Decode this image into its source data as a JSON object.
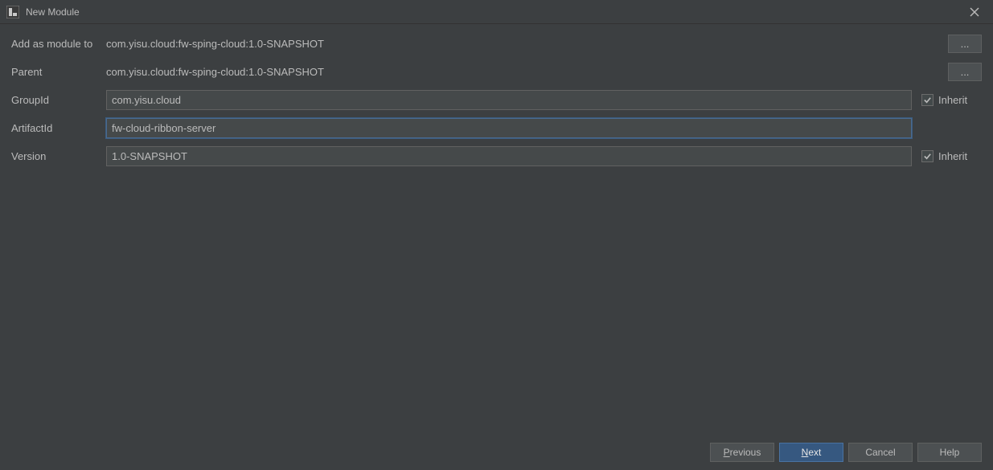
{
  "title": "New Module",
  "labels": {
    "add_as_module_to": "Add as module to",
    "parent": "Parent",
    "group_id": "GroupId",
    "artifact_id": "ArtifactId",
    "version": "Version",
    "inherit": "Inherit"
  },
  "values": {
    "add_as_module_to": "com.yisu.cloud:fw-sping-cloud:1.0-SNAPSHOT",
    "parent": "com.yisu.cloud:fw-sping-cloud:1.0-SNAPSHOT",
    "group_id": "com.yisu.cloud",
    "artifact_id": "fw-cloud-ribbon-server",
    "version": "1.0-SNAPSHOT"
  },
  "buttons": {
    "ellipsis": "...",
    "previous": "Previous",
    "next": "Next",
    "cancel": "Cancel",
    "help": "Help"
  },
  "checks": {
    "inherit_group": true,
    "inherit_version": true
  }
}
